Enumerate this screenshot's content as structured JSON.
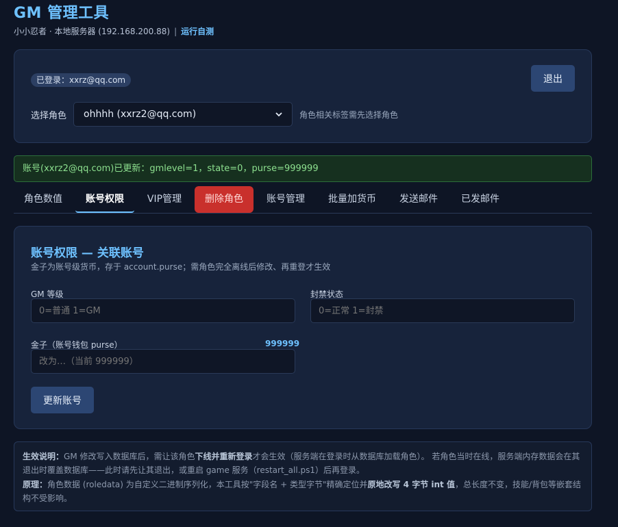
{
  "header": {
    "title": "GM 管理工具",
    "subtitle": "小小忍者 · 本地服务器 (192.168.200.88)",
    "separator": "|",
    "self_test_link": "运行自测"
  },
  "login": {
    "badge": "已登录：xxrz@qq.com",
    "logout_label": "退出",
    "role_label": "选择角色",
    "role_selected": "ohhhh (xxrz2@qq.com)",
    "role_hint": "角色相关标签需先选择角色"
  },
  "alert": {
    "message": "账号(xxrz2@qq.com)已更新：gmlevel=1，state=0，purse=999999"
  },
  "tabs": [
    {
      "label": "角色数值"
    },
    {
      "label": "账号权限"
    },
    {
      "label": "VIP管理"
    },
    {
      "label": "删除角色"
    },
    {
      "label": "账号管理"
    },
    {
      "label": "批量加货币"
    },
    {
      "label": "发送邮件"
    },
    {
      "label": "已发邮件"
    }
  ],
  "active_tab": "账号权限",
  "account_perm": {
    "title": "账号权限 — 关联账号",
    "description": "金子为账号级货币，存于 account.purse；需角色完全离线后修改、再重登才生效",
    "gm_level_label": "GM 等级",
    "gm_level_placeholder": "0=普通 1=GM",
    "ban_state_label": "封禁状态",
    "ban_state_placeholder": "0=正常 1=封禁",
    "gold_label": "金子（账号钱包 purse）",
    "gold_current": "999999",
    "gold_placeholder": "改为…（当前 999999）",
    "update_label": "更新账号"
  },
  "notes": {
    "effect_title": "生效说明：",
    "effect_p1": "GM 修改写入数据库后，需让该角色",
    "effect_bold": "下线并重新登录",
    "effect_p2": "才会生效（服务端在登录时从数据库加载角色）。 若角色当时在线，服务端内存数据会在其退出时覆盖数据库——此时请先让其退出，或重启 game 服务（restart_all.ps1）后再登录。",
    "principle_title": "原理：",
    "principle_p1": "角色数据 (roledata) 为自定义二进制序列化，本工具按\"字段名 + 类型字节\"精确定位并",
    "principle_bold": "原地改写 4 字节 int 值",
    "principle_p2": "，总长度不变，技能/背包等嵌套结构不受影响。"
  },
  "colors": {
    "accent": "#6ec1ff",
    "danger": "#c9302c",
    "success": "#8de08f",
    "background": "#0e1525",
    "card": "#17233b"
  }
}
